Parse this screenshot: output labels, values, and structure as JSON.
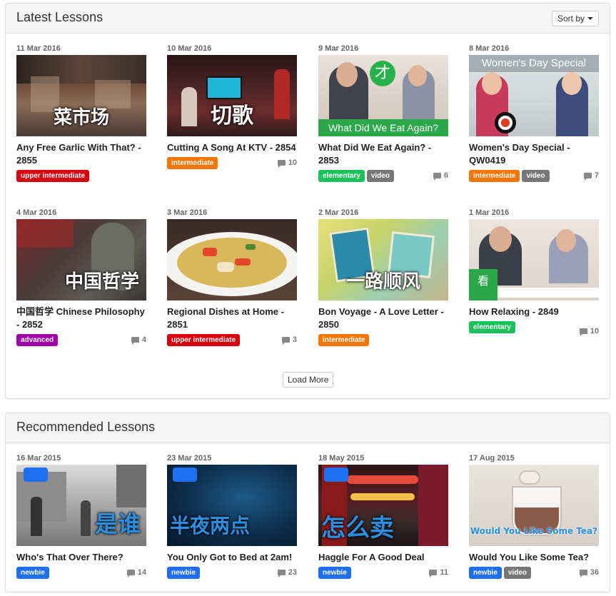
{
  "colors": {
    "upper_intermediate": "#d9000d",
    "intermediate": "#f47500",
    "elementary": "#19c35a",
    "advanced": "#a000a8",
    "newbie": "#1b6ff0",
    "video": "#777777"
  },
  "latest": {
    "title": "Latest Lessons",
    "sort_label": "Sort by",
    "load_more": "Load More",
    "cards": [
      {
        "date": "11 Mar 2016",
        "title": "Any Free Garlic With That? - 2855",
        "caption": "菜市场",
        "tags": [
          "upper intermediate"
        ],
        "comments": ""
      },
      {
        "date": "10 Mar 2016",
        "title": "Cutting A Song At KTV - 2854",
        "caption": "切歌",
        "tags": [
          "intermediate"
        ],
        "comments": "10"
      },
      {
        "date": "9 Mar 2016",
        "title": "What Did We Eat Again? - 2853",
        "caption": "What Did We Eat Again?",
        "tags": [
          "elementary",
          "video"
        ],
        "comments": "6"
      },
      {
        "date": "8 Mar 2016",
        "title": "Women's Day Special - QW0419",
        "caption": "Women's Day Special",
        "tags": [
          "intermediate",
          "video"
        ],
        "comments": "7"
      },
      {
        "date": "4 Mar 2016",
        "title": "中国哲学 Chinese Philosophy - 2852",
        "caption": "中国哲学",
        "tags": [
          "advanced"
        ],
        "comments": "4"
      },
      {
        "date": "3 Mar 2016",
        "title": "Regional Dishes at Home - 2851",
        "caption": "",
        "tags": [
          "upper intermediate"
        ],
        "comments": "3"
      },
      {
        "date": "2 Mar 2016",
        "title": "Bon Voyage - A Love Letter - 2850",
        "caption": "一路顺风",
        "tags": [
          "intermediate"
        ],
        "comments": ""
      },
      {
        "date": "1 Mar 2016",
        "title": "How Relaxing - 2849",
        "caption": "",
        "tags": [
          "elementary"
        ],
        "comments": "10"
      }
    ]
  },
  "recommended": {
    "title": "Recommended Lessons",
    "cards": [
      {
        "date": "16 Mar 2015",
        "title": "Who's That Over There?",
        "caption": "是谁",
        "tags": [
          "newbie"
        ],
        "comments": "14"
      },
      {
        "date": "23 Mar 2015",
        "title": "You Only Got to Bed at 2am!",
        "caption": "半夜两点",
        "tags": [
          "newbie"
        ],
        "comments": "23"
      },
      {
        "date": "18 May 2015",
        "title": "Haggle For A Good Deal",
        "caption": "怎么卖",
        "tags": [
          "newbie"
        ],
        "comments": "11"
      },
      {
        "date": "17 Aug 2015",
        "title": "Would You Like Some Tea?",
        "caption": "Would You Like Some Tea?",
        "tags": [
          "newbie",
          "video"
        ],
        "comments": "36"
      }
    ]
  }
}
